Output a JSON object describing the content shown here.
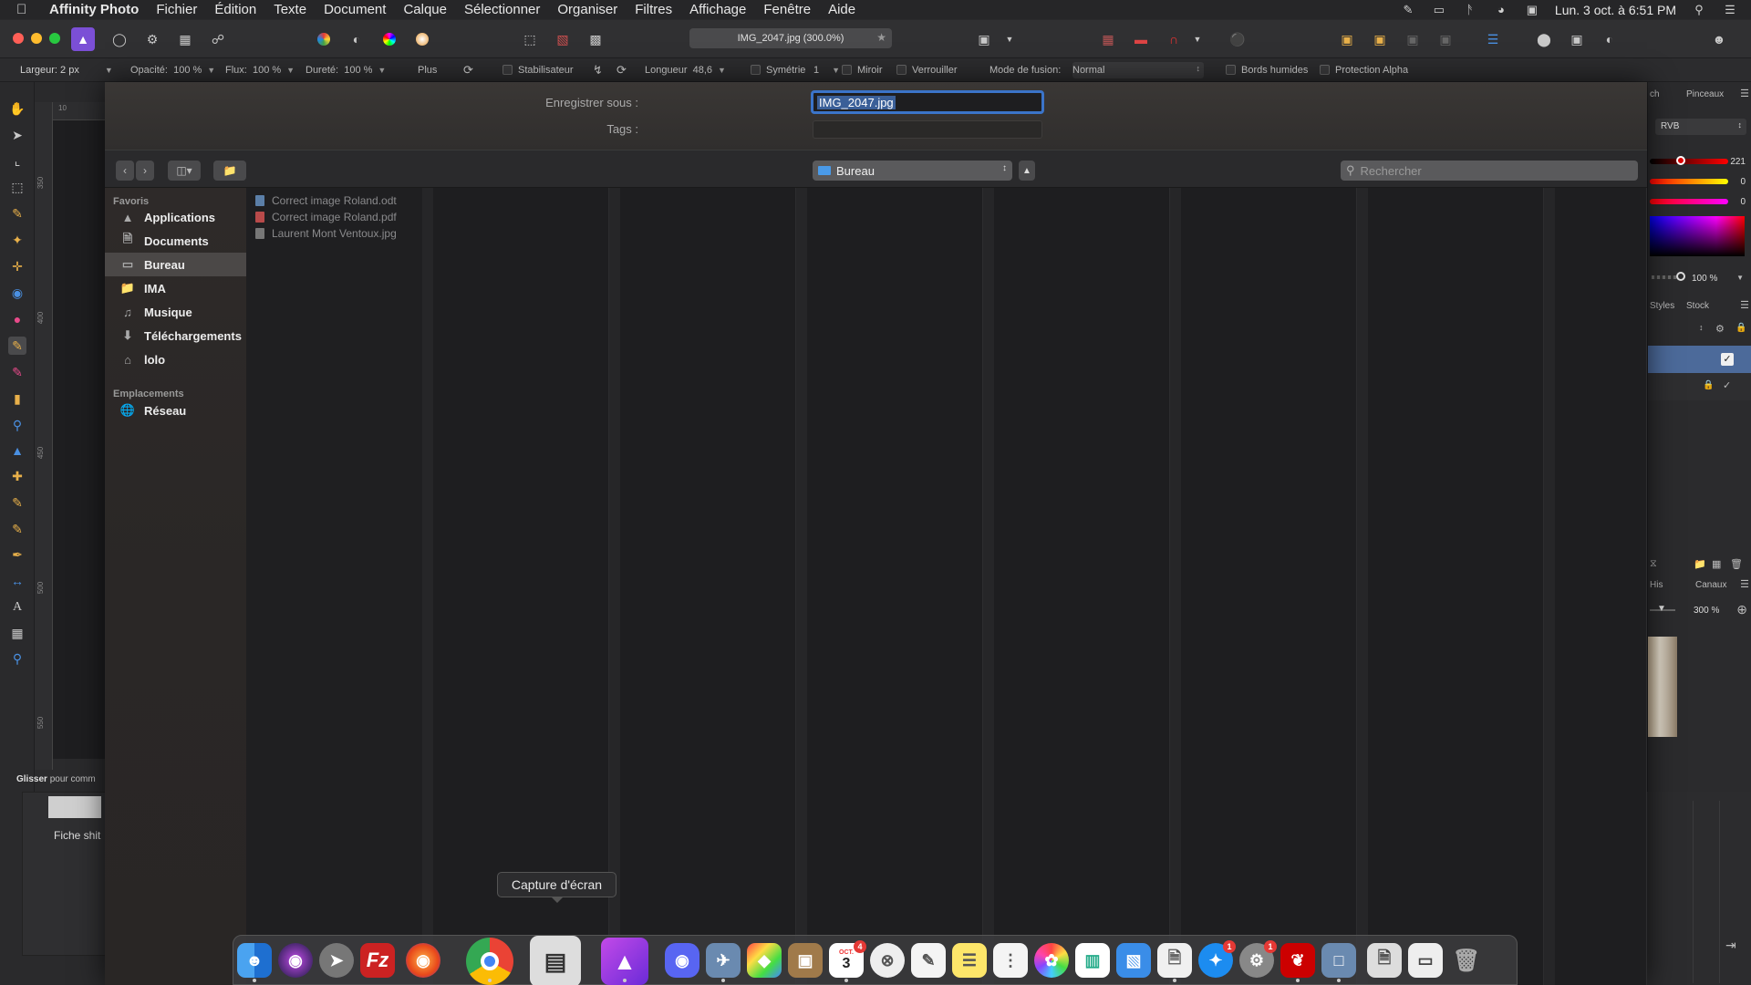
{
  "menubar": {
    "app_name": "Affinity Photo",
    "items": [
      "Fichier",
      "Édition",
      "Texte",
      "Document",
      "Calque",
      "Sélectionner",
      "Organiser",
      "Filtres",
      "Affichage",
      "Fenêtre",
      "Aide"
    ],
    "clock": "Lun. 3 oct. à  6:51 PM"
  },
  "toolbar": {
    "document_tab": "IMG_2047.jpg (300.0%)"
  },
  "context_bar": {
    "width_label": "Largeur:",
    "width_value": "2 px",
    "opacity_label": "Opacité:",
    "opacity_value": "100 %",
    "flow_label": "Flux:",
    "flow_value": "100 %",
    "hardness_label": "Dureté:",
    "hardness_value": "100 %",
    "more_label": "Plus",
    "stabilizer_label": "Stabilisateur",
    "length_label": "Longueur",
    "length_value": "48,6",
    "symmetry_label": "Symétrie",
    "symmetry_value": "1",
    "mirror_label": "Miroir",
    "lock_label": "Verrouiller",
    "blend_label": "Mode de fusion:",
    "blend_value": "Normal",
    "wet_edges_label": "Bords humides",
    "alpha_label": "Protection Alpha"
  },
  "left_status": {
    "bold": "Glisser",
    "rest": "pour comm"
  },
  "ruler": {
    "unit": "px",
    "labels": [
      "350",
      "400",
      "450",
      "500",
      "550"
    ],
    "top_label": "10"
  },
  "right_panel": {
    "tab_left": "ch",
    "tab_right": "Pinceaux",
    "color_mode": "RVB",
    "red_value": "221",
    "green_value": "0",
    "blue_value": "0",
    "opacity_value": "100 %",
    "styles_tab": "Styles",
    "stock_tab": "Stock",
    "his_tab": "His",
    "channels_tab": "Canaux",
    "zoom_value": "300 %"
  },
  "save_sheet": {
    "save_as_label": "Enregistrer sous :",
    "filename": "IMG_2047.jpg",
    "tags_label": "Tags :",
    "location": "Bureau",
    "search_placeholder": "Rechercher",
    "favorites_header": "Favoris",
    "favorites": [
      "Applications",
      "Documents",
      "Bureau",
      "IMA",
      "Musique",
      "Téléchargements",
      "lolo"
    ],
    "locations_header": "Emplacements",
    "locations": [
      "Réseau"
    ],
    "files": [
      "Correct image Roland.odt",
      "Correct image Roland.pdf",
      "Laurent Mont Ventoux.jpg"
    ]
  },
  "background_window": {
    "label": "Fiche shit"
  },
  "dock": {
    "tooltip": "Capture d'écran",
    "calendar_day": "3",
    "calendar_month": "OCT.",
    "calendar_badge": "4",
    "appstore_badge": "1",
    "prefs_badge": "1"
  }
}
